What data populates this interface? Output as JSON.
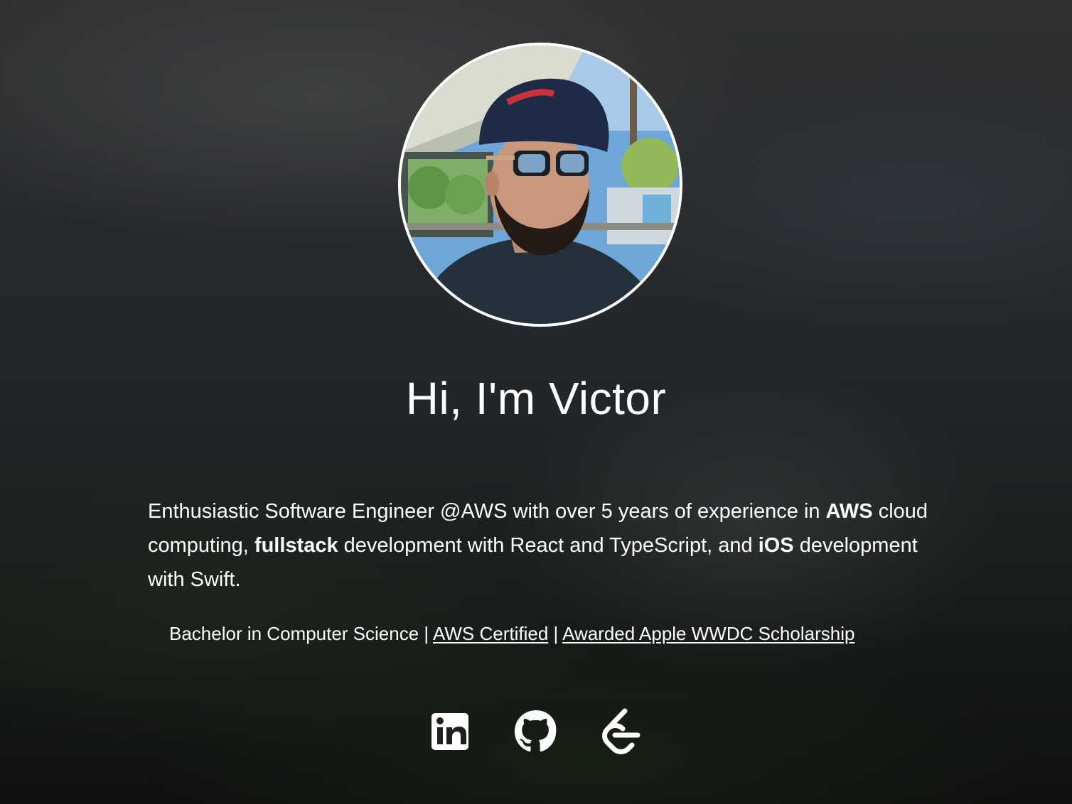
{
  "hero": {
    "avatar_alt": "Victor profile photo",
    "title": "Hi, I'm Victor"
  },
  "bio": {
    "part1": "Enthusiastic Software Engineer @AWS with over 5 years of experience in ",
    "bold1": "AWS",
    "part2": " cloud computing, ",
    "bold2": "fullstack",
    "part3": " development with React and TypeScript, and ",
    "bold3": "iOS",
    "part4": " development with Swift."
  },
  "credentials": {
    "degree": "Bachelor in Computer Science",
    "separator": "|",
    "aws_link": "AWS Certified",
    "wwdc_link": "Awarded Apple WWDC Scholarship"
  },
  "socials": [
    {
      "icon": "linkedin-icon"
    },
    {
      "icon": "github-icon"
    },
    {
      "icon": "leetcode-icon"
    }
  ],
  "colors": {
    "text": "#ffffff",
    "avatar_border": "#ffffff"
  }
}
